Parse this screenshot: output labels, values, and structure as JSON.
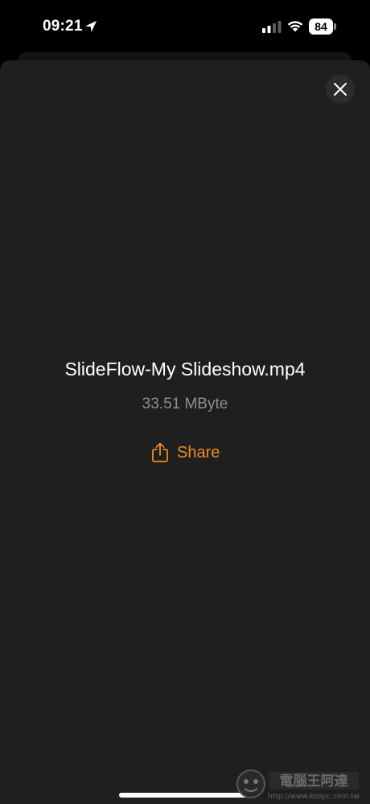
{
  "status_bar": {
    "time": "09:21",
    "battery_level": "84",
    "icons": [
      "location-arrow-icon",
      "cellular-signal-icon",
      "wifi-icon",
      "battery-icon"
    ]
  },
  "file": {
    "name": "SlideFlow-My Slideshow.mp4",
    "size": "33.51 MByte"
  },
  "actions": {
    "share_label": "Share",
    "share_icon": "share-icon",
    "close_icon": "close-icon"
  },
  "colors": {
    "background": "#000000",
    "sheet": "#1f1f1f",
    "accent": "#f08a24",
    "secondary_text": "#8e8e93"
  }
}
